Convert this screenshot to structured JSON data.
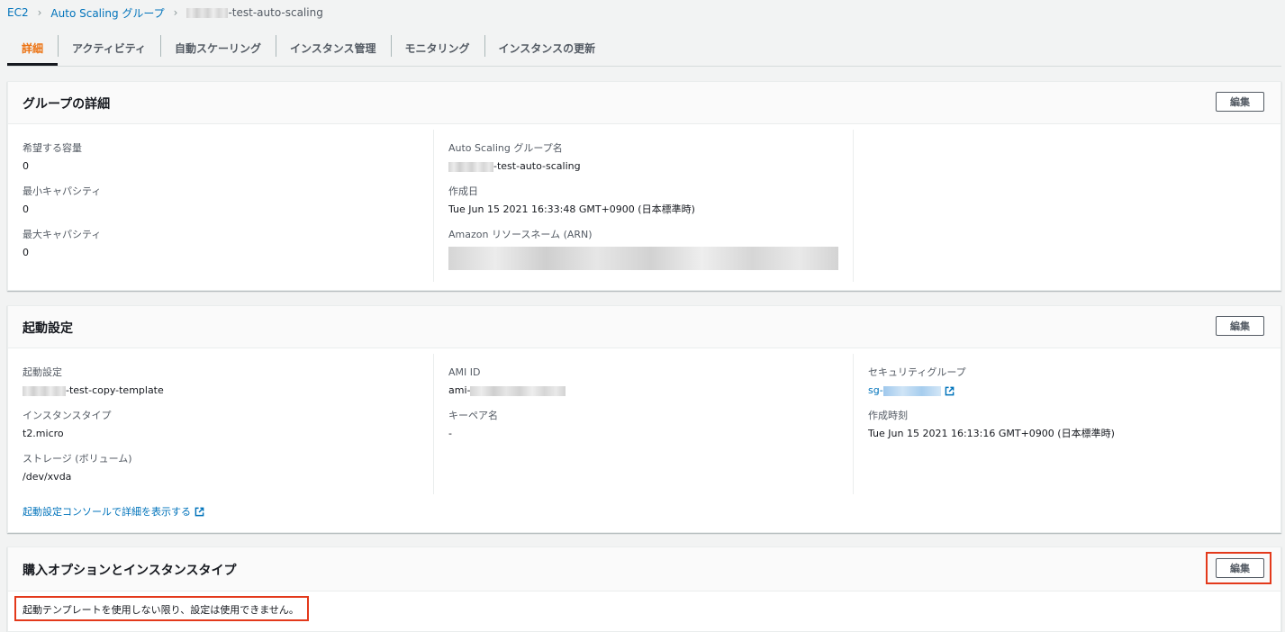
{
  "breadcrumb": {
    "items": [
      "EC2",
      "Auto Scaling グループ"
    ],
    "current_suffix": "-test-auto-scaling"
  },
  "tabs": [
    "詳細",
    "アクティビティ",
    "自動スケーリング",
    "インスタンス管理",
    "モニタリング",
    "インスタンスの更新"
  ],
  "group_details": {
    "title": "グループの詳細",
    "edit_label": "編集",
    "desired_capacity_label": "希望する容量",
    "desired_capacity": "0",
    "min_capacity_label": "最小キャパシティ",
    "min_capacity": "0",
    "max_capacity_label": "最大キャパシティ",
    "max_capacity": "0",
    "asg_name_label": "Auto Scaling グループ名",
    "asg_name_suffix": "-test-auto-scaling",
    "created_label": "作成日",
    "created": "Tue Jun 15 2021 16:33:48 GMT+0900 (日本標準時)",
    "arn_label": "Amazon リソースネーム (ARN)"
  },
  "launch_config": {
    "title": "起動設定",
    "edit_label": "編集",
    "lc_label": "起動設定",
    "lc_suffix": "-test-copy-template",
    "instance_type_label": "インスタンスタイプ",
    "instance_type": "t2.micro",
    "storage_label": "ストレージ (ボリューム)",
    "storage": "/dev/xvda",
    "ami_label": "AMI ID",
    "ami_prefix": "ami-",
    "keypair_label": "キーペア名",
    "keypair": "-",
    "sg_label": "セキュリティグループ",
    "sg_prefix": "sg-",
    "created_label": "作成時刻",
    "created": "Tue Jun 15 2021 16:13:16 GMT+0900 (日本標準時)",
    "console_link": "起動設定コンソールで詳細を表示する"
  },
  "purchase_options": {
    "title": "購入オプションとインスタンスタイプ",
    "edit_label": "編集",
    "message": "起動テンプレートを使用しない限り、設定は使用できません。"
  },
  "colors": {
    "accent_orange": "#ec7211",
    "link_blue": "#0073bb",
    "highlight_red": "#e3391b"
  }
}
